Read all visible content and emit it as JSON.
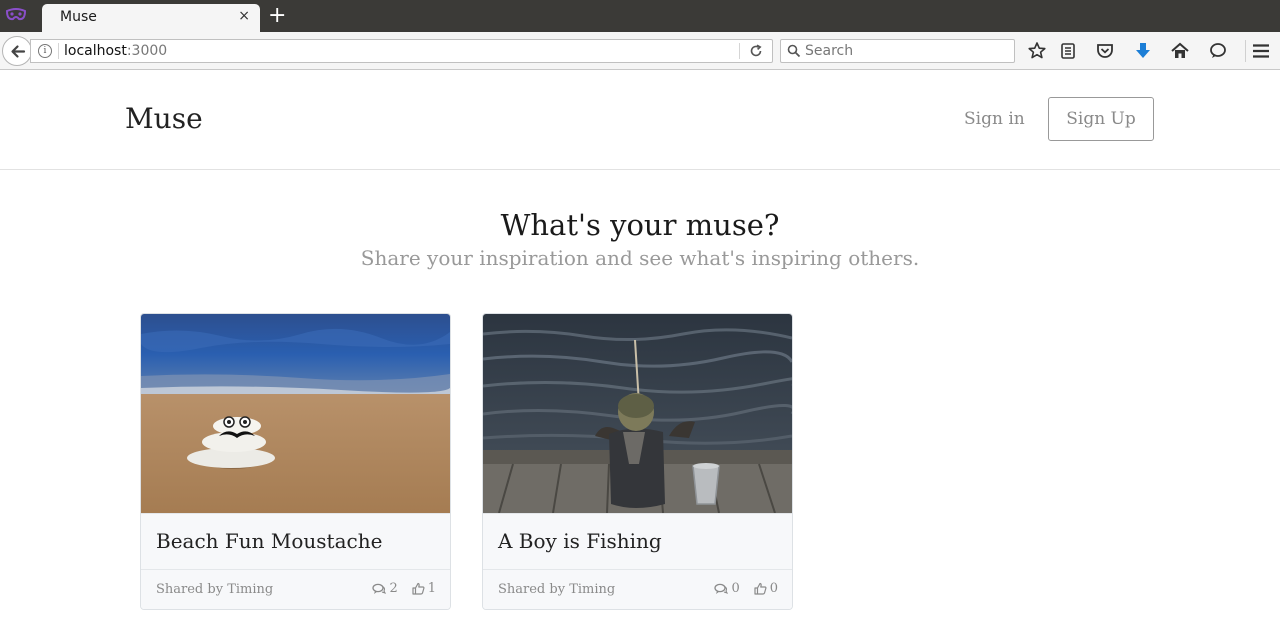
{
  "browser": {
    "tab_title": "Muse",
    "tab_close": "×",
    "new_tab": "+",
    "url_host": "localhost",
    "url_port": ":3000",
    "search_placeholder": "Search"
  },
  "header": {
    "brand": "Muse",
    "signin_label": "Sign in",
    "signup_label": "Sign Up"
  },
  "hero": {
    "title": "What's your muse?",
    "subtitle": "Share your inspiration and see what's inspiring others."
  },
  "cards": [
    {
      "title": "Beach Fun Moustache",
      "shared_by": "Shared by Timing",
      "comments": "2",
      "likes": "1"
    },
    {
      "title": "A Boy is Fishing",
      "shared_by": "Shared by Timing",
      "comments": "0",
      "likes": "0"
    }
  ],
  "colors": {
    "accent_download": "#1c7ed6",
    "extension_mask": "#7a3fb0"
  }
}
